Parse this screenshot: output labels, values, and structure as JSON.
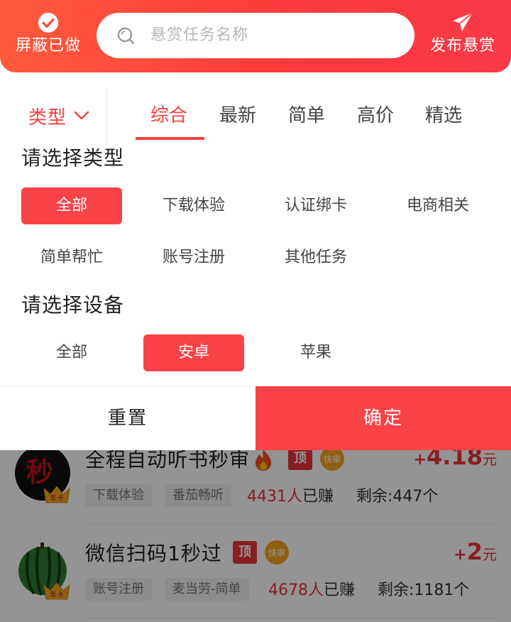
{
  "header": {
    "left_label": "屏蔽已做",
    "left_icon": "check-circle-icon",
    "search_placeholder": "悬赏任务名称",
    "right_label": "发布悬赏",
    "right_icon": "paper-plane-icon",
    "accent": "#f94347"
  },
  "tabs": {
    "type_label": "类型",
    "items": [
      "综合",
      "最新",
      "简单",
      "高价",
      "精选"
    ],
    "active": "综合"
  },
  "filter": {
    "type_title": "请选择类型",
    "types": [
      "全部",
      "下载体验",
      "认证绑卡",
      "电商相关",
      "简单帮忙",
      "账号注册",
      "其他任务"
    ],
    "selected_type": "全部",
    "device_title": "请选择设备",
    "devices": [
      "全部",
      "安卓",
      "苹果"
    ],
    "selected_device": "安卓",
    "reset_label": "重置",
    "confirm_label": "确定"
  },
  "tasks": [
    {
      "title": "全程自动听书秒审",
      "hot": true,
      "top_badge": "顶",
      "fast_badge": "快审",
      "price_plus": "+",
      "price": "4.18",
      "unit": "元",
      "tags": [
        "下载体验",
        "番茄畅听"
      ],
      "earned_count": "4431人",
      "earned_suffix": "已赚",
      "remaining": "剩余:447个",
      "avatar_text": "秒",
      "avatar_badge": "年卡"
    },
    {
      "title": "微信扫码1秒过",
      "hot": false,
      "top_badge": "顶",
      "fast_badge": "快审",
      "price_plus": "+",
      "price": "2",
      "unit": "元",
      "tags": [
        "账号注册",
        "麦当劳-简单"
      ],
      "earned_count": "4678人",
      "earned_suffix": "已赚",
      "remaining": "剩余:1181个",
      "avatar_badge": "年卡"
    }
  ]
}
